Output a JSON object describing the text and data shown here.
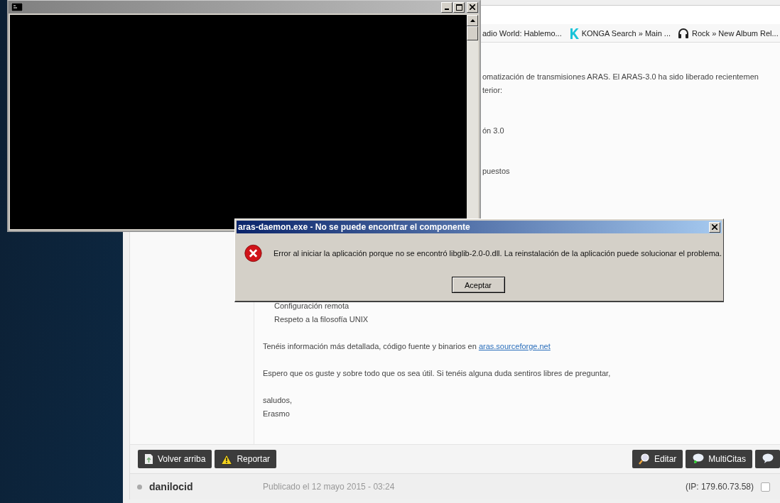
{
  "browser": {
    "bookmarks": [
      {
        "kind": "plain",
        "label": "adio World: Hablemo..."
      },
      {
        "kind": "letter-k",
        "label": "KONGA Search » Main ..."
      },
      {
        "kind": "headphones",
        "label": "Rock » New Album Rel..."
      }
    ],
    "post": {
      "blocks": [
        {
          "kind": "fragment",
          "lines": [
            "omatización de transmisiones ARAS. El ARAS-3.0 ha sido liberado recientemen",
            "terior:"
          ]
        },
        {
          "kind": "fragment",
          "lines": [
            "ón 3.0"
          ]
        },
        {
          "kind": "fragment",
          "lines": [
            "puestos"
          ]
        },
        {
          "kind": "list",
          "lines": [
            "Configuración remota",
            "Respeto a la filosofía UNIX"
          ]
        },
        {
          "kind": "paragraph",
          "lines": [
            "Tenéis información más detallada, código fuente y binarios en "
          ],
          "link": "aras.sourceforge.net"
        },
        {
          "kind": "paragraph",
          "lines": [
            "Espero que os guste y sobre todo que os sea útil. Si tenéis alguna duda sentiros libres de preguntar,"
          ]
        },
        {
          "kind": "paragraph",
          "lines": [
            "saludos,",
            "Erasmo"
          ]
        }
      ],
      "left_buttons": [
        {
          "kind": "up",
          "label": "Volver arriba"
        },
        {
          "kind": "warning",
          "label": "Reportar"
        }
      ],
      "right_buttons": [
        {
          "kind": "edit",
          "label": "Editar"
        },
        {
          "kind": "multiquote",
          "label": "MultiCitas"
        },
        {
          "kind": "quote"
        }
      ]
    },
    "next_post": {
      "author": "danilocid",
      "published": "Publicado el 12 mayo 2015 - 03:24",
      "ip": "(IP: 179.60.73.58)",
      "checked": false
    }
  },
  "dialog": {
    "title": "aras-daemon.exe - No se puede encontrar el componente",
    "message": "Error al iniciar la aplicación porque no se encontró libglib-2.0-0.dll. La reinstalación de la aplicación puede solucionar el problema.",
    "button": "Aceptar"
  }
}
